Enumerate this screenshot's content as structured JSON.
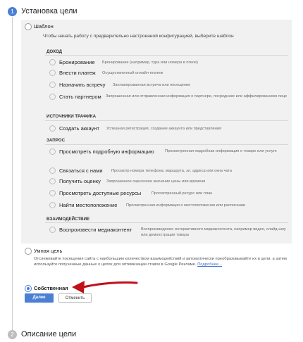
{
  "step1": {
    "number": "1",
    "title": "Установка цели"
  },
  "step2": {
    "number": "2",
    "title": "Описание цели"
  },
  "template": {
    "label": "Шаблон",
    "hint": "Чтобы начать работу с предварительно настроенной конфигурацией, выберите шаблон",
    "categories": [
      {
        "title": "ДОХОД",
        "options": [
          {
            "label": "Бронирование",
            "desc": "Бронирование (например, тура или номера в отеле)"
          },
          {
            "label": "Внести платеж",
            "desc": "Осуществленный онлайн-платеж"
          },
          {
            "label": "Назначить встречу",
            "desc": "Запланированная встреча или посещение"
          },
          {
            "label": "Стать партнером",
            "desc": "Запрошенная или отправленная информация о партнере, посреднике или аффилированном лице"
          }
        ]
      },
      {
        "title": "ИСТОЧНИКИ ТРАФИКА",
        "options": [
          {
            "label": "Создать аккаунт",
            "desc": "Успешная регистрация, создание аккаунта или представления"
          }
        ]
      },
      {
        "title": "ЗАПРОС",
        "options": [
          {
            "label": "Просмотреть подробную информацию",
            "desc": "Просмотренная подробная информация о товаре или услуге"
          },
          {
            "label": "Связаться с нами",
            "desc": "Просмотр номера телефона, маршрута, эл. адреса или окна чата"
          },
          {
            "label": "Получить оценку",
            "desc": "Запрошенное оценочное значение цены или времени"
          },
          {
            "label": "Просмотреть доступные ресурсы",
            "desc": "Просмотренный ресурс или план"
          },
          {
            "label": "Найти местоположение",
            "desc": "Просмотренная информация о местоположении или расписании"
          }
        ]
      },
      {
        "title": "ВЗАИМОДЕЙСТВИЕ",
        "options": [
          {
            "label": "Воспроизвести медиаконтент",
            "desc": "Воспроизведение интерактивного медиаконтента, например видео, слайд-шоу или демонстрации товара"
          }
        ]
      }
    ]
  },
  "smart_goal": {
    "label": "Умная цель",
    "desc": "Отслеживайте посещения сайта с наибольшим количеством взаимодействий и автоматически преобразовывайте их в цели, а затем используйте полученные данные о целях для оптимизации ставок в Google Рекламе.",
    "more_link": "Подробнее..."
  },
  "custom": {
    "label": "Собственная",
    "selected": true
  },
  "buttons": {
    "continue": "Далее",
    "cancel": "Отменить"
  },
  "colors": {
    "accent": "#4a7fd4",
    "arrow": "#c0101a",
    "panel": "#f1f1f1"
  }
}
